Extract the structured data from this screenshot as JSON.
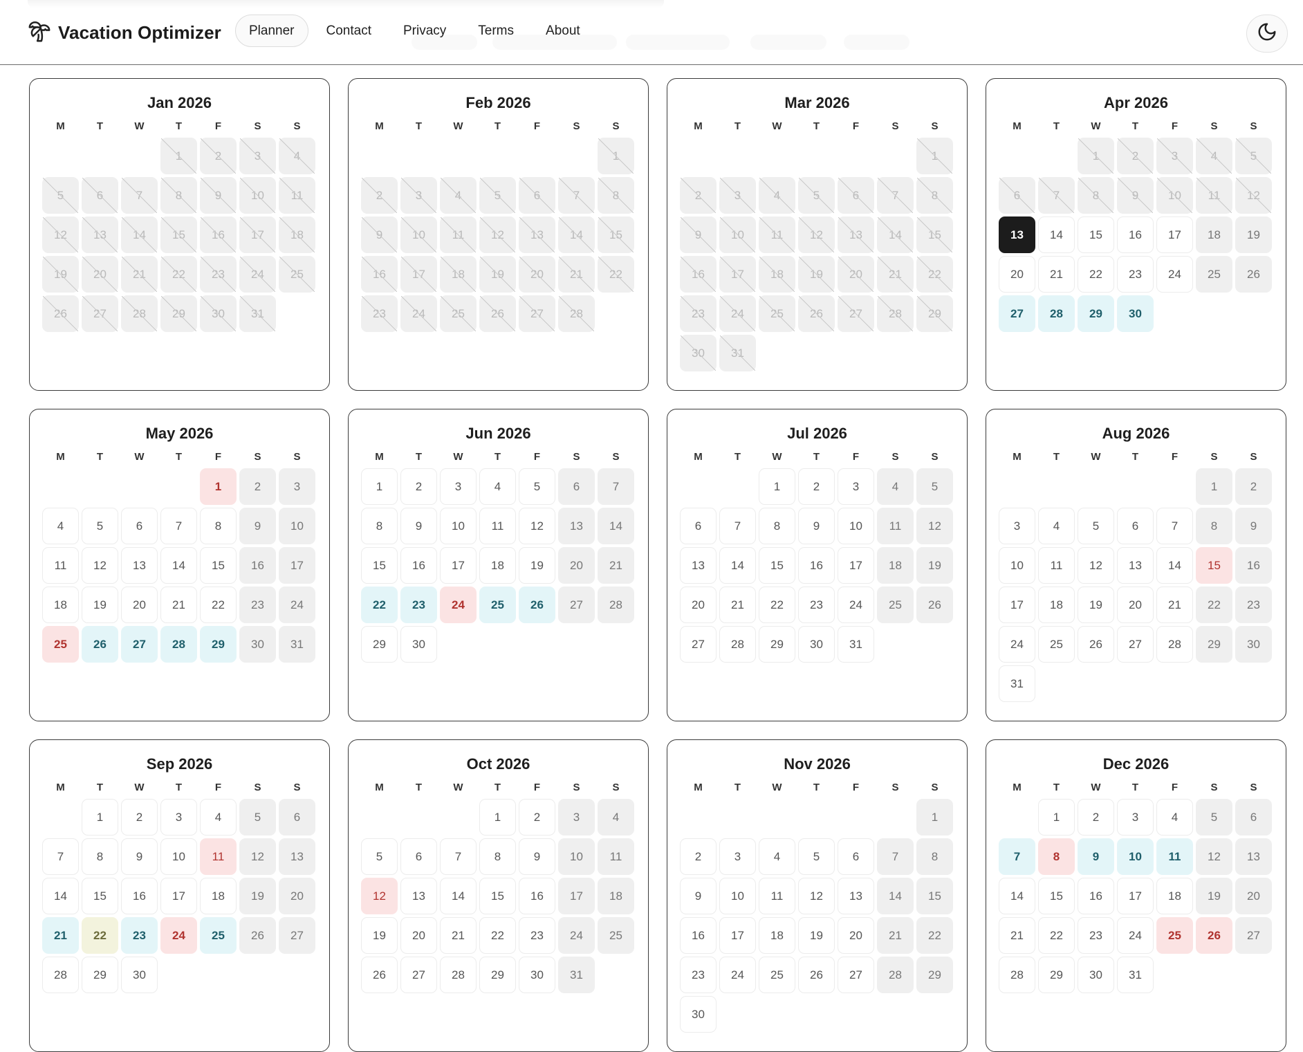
{
  "app": {
    "title": "Vacation Optimizer"
  },
  "nav": [
    {
      "label": "Planner",
      "active": true
    },
    {
      "label": "Contact"
    },
    {
      "label": "Privacy"
    },
    {
      "label": "Terms"
    },
    {
      "label": "About"
    }
  ],
  "theme_toggle": {
    "icon": "moon-icon"
  },
  "weekday_labels": [
    "M",
    "T",
    "W",
    "T",
    "F",
    "S",
    "S"
  ],
  "colors": {
    "vacation": "#e3f5f8",
    "holiday": "#fbe3e3",
    "today": "#1c1c1c",
    "weekend": "#efefef",
    "special": "#f3f3dd"
  },
  "months": [
    {
      "title": "Jan 2026",
      "offset": 3,
      "days": 31,
      "past_until": 31
    },
    {
      "title": "Feb 2026",
      "offset": 6,
      "days": 28,
      "past_until": 28
    },
    {
      "title": "Mar 2026",
      "offset": 6,
      "days": 31,
      "past_until": 31
    },
    {
      "title": "Apr 2026",
      "offset": 2,
      "days": 30,
      "past_until": 12,
      "today": 13,
      "vacation": [
        27,
        28,
        29,
        30
      ]
    },
    {
      "title": "May 2026",
      "offset": 4,
      "days": 31,
      "holiday": [
        1,
        25
      ],
      "vacation": [
        26,
        27,
        28,
        29
      ]
    },
    {
      "title": "Jun 2026",
      "offset": 0,
      "days": 30,
      "holiday": [
        24
      ],
      "vacation": [
        22,
        23,
        25,
        26
      ]
    },
    {
      "title": "Jul 2026",
      "offset": 2,
      "days": 31
    },
    {
      "title": "Aug 2026",
      "offset": 5,
      "days": 31,
      "holiday_plain": [
        15
      ]
    },
    {
      "title": "Sep 2026",
      "offset": 1,
      "days": 30,
      "holiday_plain": [
        11
      ],
      "holiday": [
        24
      ],
      "vacation": [
        21,
        23,
        25
      ],
      "special": [
        22
      ]
    },
    {
      "title": "Oct 2026",
      "offset": 3,
      "days": 31,
      "holiday_plain": [
        12
      ]
    },
    {
      "title": "Nov 2026",
      "offset": 6,
      "days": 30
    },
    {
      "title": "Dec 2026",
      "offset": 1,
      "days": 31,
      "holiday": [
        8,
        25,
        26
      ],
      "vacation": [
        7,
        9,
        10,
        11
      ]
    }
  ]
}
